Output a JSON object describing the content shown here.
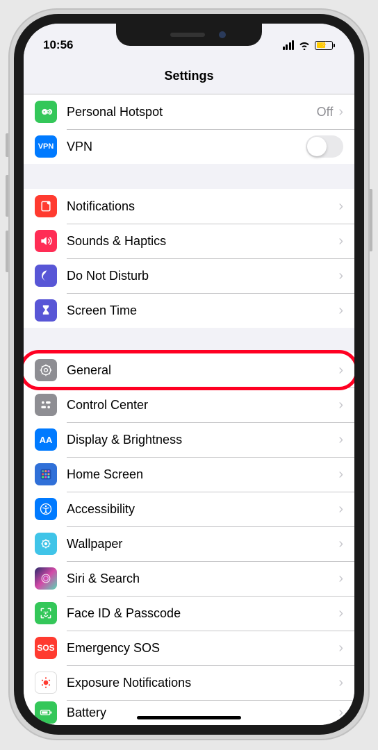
{
  "status": {
    "time": "10:56"
  },
  "header": {
    "title": "Settings"
  },
  "section1": {
    "hotspot": {
      "label": "Personal Hotspot",
      "value": "Off"
    },
    "vpn": {
      "label": "VPN"
    }
  },
  "section2": {
    "notifications": {
      "label": "Notifications"
    },
    "sounds": {
      "label": "Sounds & Haptics"
    },
    "dnd": {
      "label": "Do Not Disturb"
    },
    "screentime": {
      "label": "Screen Time"
    }
  },
  "section3": {
    "general": {
      "label": "General"
    },
    "controlcenter": {
      "label": "Control Center"
    },
    "display": {
      "label": "Display & Brightness"
    },
    "homescreen": {
      "label": "Home Screen"
    },
    "accessibility": {
      "label": "Accessibility"
    },
    "wallpaper": {
      "label": "Wallpaper"
    },
    "siri": {
      "label": "Siri & Search"
    },
    "faceid": {
      "label": "Face ID & Passcode"
    },
    "sos": {
      "label": "Emergency SOS"
    },
    "exposure": {
      "label": "Exposure Notifications"
    },
    "battery": {
      "label": "Battery"
    }
  },
  "highlight": {
    "target": "general"
  }
}
